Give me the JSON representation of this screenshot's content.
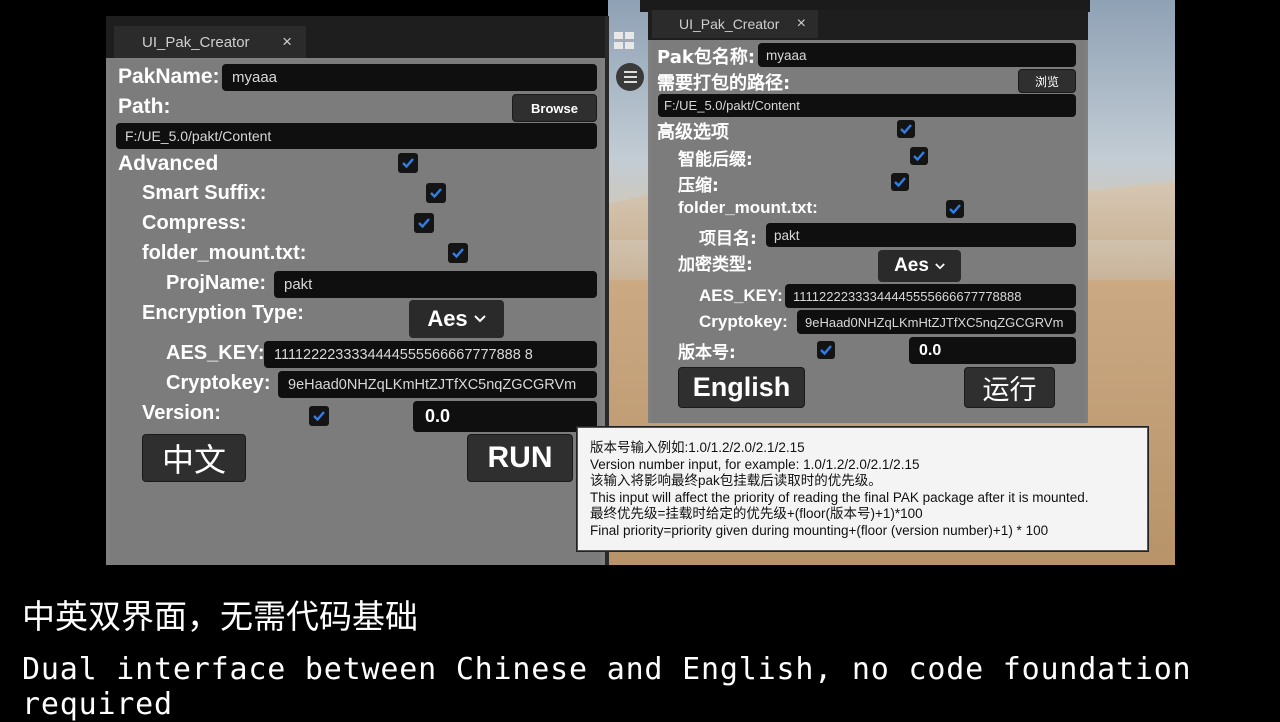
{
  "caption": {
    "chinese": "中英双界面，无需代码基础",
    "english": "Dual interface between Chinese and English, no code foundation required"
  },
  "english_window": {
    "tab_title": "UI_Pak_Creator",
    "tab_close": "×",
    "pak_name_label": "PakName:",
    "pak_name_value": "myaaa",
    "path_label": "Path:",
    "browse_button": "Browse",
    "path_value": "F:/UE_5.0/pakt/Content",
    "advanced_label": "Advanced",
    "smart_suffix_label": "Smart Suffix:",
    "compress_label": "Compress:",
    "folder_mount_label": "folder_mount.txt:",
    "proj_name_label": "ProjName:",
    "proj_name_value": "pakt",
    "encryption_type_label": "Encryption Type:",
    "encryption_type_value": "Aes",
    "aes_key_label": "AES_KEY:",
    "aes_key_value": "1111222233334444555566667777888 8",
    "cryptokey_label": "Cryptokey:",
    "cryptokey_value": "9eHaad0NHZqLKmHtZJTfXC5nqZGCGRVm",
    "version_label": "Version:",
    "version_value": "0.0",
    "language_button": "中文",
    "run_button": "RUN"
  },
  "chinese_window": {
    "tab_title": "UI_Pak_Creator",
    "tab_close": "×",
    "pak_name_label": "Pak包名称:",
    "pak_name_value": "myaaa",
    "path_label": "需要打包的路径:",
    "browse_button": "浏览",
    "path_value": "F:/UE_5.0/pakt/Content",
    "advanced_label": "高级选项",
    "smart_suffix_label": "智能后缀:",
    "compress_label": "压缩:",
    "folder_mount_label": "folder_mount.txt:",
    "proj_name_label": "项目名:",
    "proj_name_value": "pakt",
    "encryption_type_label": "加密类型:",
    "encryption_type_value": "Aes",
    "aes_key_label": "AES_KEY:",
    "aes_key_value": "11112222333344445555666677778888",
    "cryptokey_label": "Cryptokey:",
    "cryptokey_value": "9eHaad0NHZqLKmHtZJTfXC5nqZGCGRVm",
    "version_label": "版本号:",
    "version_value": "0.0",
    "language_button": "English",
    "run_button": "运行"
  },
  "tooltip": {
    "lines": [
      "版本号输入例如:1.0/1.2/2.0/2.1/2.15",
      "Version number input, for example: 1.0/1.2/2.0/2.1/2.15",
      "该输入将影响最终pak包挂载后读取时的优先级。",
      "This input will affect the priority of reading the final PAK package after it is mounted.",
      "最终优先级=挂载时给定的优先级+(floor(版本号)+1)*100",
      "Final priority=priority given during mounting+(floor (version number)+1) * 100"
    ]
  },
  "colors": {
    "panel_gray": "#808080",
    "field_black": "#0f0f0f",
    "checkbox_blue": "#2f7fe8"
  }
}
